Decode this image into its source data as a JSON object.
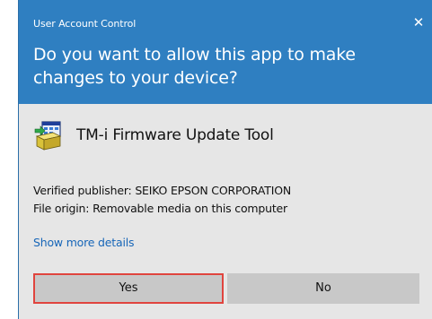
{
  "window": {
    "title": "User Account Control",
    "close_glyph": "✕"
  },
  "header": {
    "question": "Do you want to allow this app to make changes to your device?"
  },
  "app": {
    "icon": "installer-app-icon",
    "name": "TM-i Firmware Update Tool"
  },
  "details": {
    "publisher": "Verified publisher: SEIKO EPSON CORPORATION",
    "origin": "File origin: Removable media on this computer",
    "show_more_label": "Show more details"
  },
  "buttons": {
    "yes_label": "Yes",
    "no_label": "No",
    "focused": "yes"
  },
  "colors": {
    "header_bg": "#2f7fc1",
    "body_bg": "#e6e6e6",
    "button_bg": "#c8c8c8",
    "focus_border": "#e0443e",
    "link": "#1766b8"
  }
}
